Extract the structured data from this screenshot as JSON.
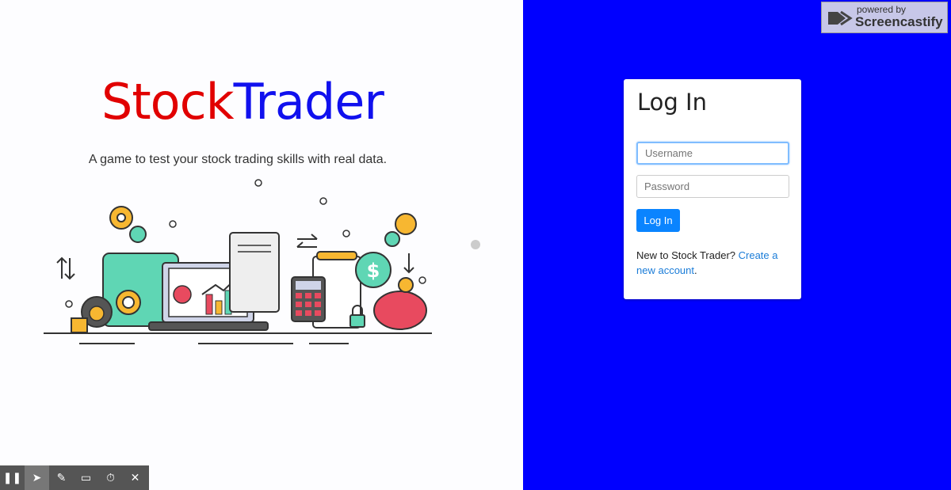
{
  "brand": {
    "stock": "Stock",
    "trader": "Trader"
  },
  "tagline": "A game to test your stock trading skills with real data.",
  "login": {
    "title": "Log In",
    "username_placeholder": "Username",
    "password_placeholder": "Password",
    "button_label": "Log In",
    "signup_prefix": "New to Stock Trader? ",
    "signup_link": "Create a new account",
    "signup_suffix": "."
  },
  "screencastify": {
    "powered_by": "powered by",
    "name": "Screencastify"
  },
  "colors": {
    "brand_red": "#e10000",
    "brand_blue": "#1010ee",
    "panel_blue": "#0000ff",
    "button_blue": "#0a84ff"
  },
  "toolbar_icons": [
    "pause-icon",
    "cursor-icon",
    "pen-icon",
    "eraser-icon",
    "timer-icon",
    "close-icon"
  ]
}
